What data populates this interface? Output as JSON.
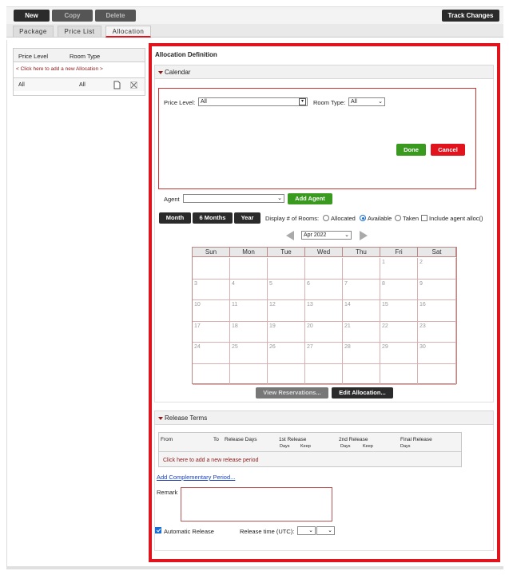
{
  "toolbar": {
    "new": "New",
    "copy": "Copy",
    "delete": "Delete",
    "track_changes": "Track Changes"
  },
  "tabs": [
    {
      "label": "Package"
    },
    {
      "label": "Price List"
    },
    {
      "label": "Allocation",
      "active": true
    }
  ],
  "left": {
    "col_price_level": "Price Level",
    "col_room_type": "Room Type",
    "add_link": "< Click here to add a new Allocation >",
    "rows": [
      {
        "price_level": "All",
        "room_type": "All"
      }
    ]
  },
  "definition": {
    "title": "Allocation Definition",
    "calendar_section": "Calendar",
    "price_level_label": "Price Level:",
    "price_level_value": "All",
    "room_type_label": "Room Type:",
    "room_type_value": "All",
    "done": "Done",
    "cancel": "Cancel",
    "agent_label": "Agent",
    "agent_value": "",
    "add_agent": "Add Agent",
    "view_month": "Month",
    "view_6months": "6 Months",
    "view_year": "Year",
    "display_label": "Display # of Rooms:",
    "opt_allocated": "Allocated",
    "opt_available": "Available",
    "opt_taken": "Taken",
    "include_agent": "Include agent alloc()",
    "month_value": "Apr 2022",
    "weekdays": [
      "Sun",
      "Mon",
      "Tue",
      "Wed",
      "Thu",
      "Fri",
      "Sat"
    ],
    "days": [
      [
        "",
        "",
        "",
        "",
        "",
        "1",
        "2"
      ],
      [
        "3",
        "4",
        "5",
        "6",
        "7",
        "8",
        "9"
      ],
      [
        "10",
        "11",
        "12",
        "13",
        "14",
        "15",
        "16"
      ],
      [
        "17",
        "18",
        "19",
        "20",
        "21",
        "22",
        "23"
      ],
      [
        "24",
        "25",
        "26",
        "27",
        "28",
        "29",
        "30"
      ],
      [
        "",
        "",
        "",
        "",
        "",
        "",
        ""
      ]
    ],
    "view_reservations": "View Reservations...",
    "edit_allocation": "Edit Allocation..."
  },
  "release": {
    "section": "Release Terms",
    "col_from": "From",
    "col_to": "To",
    "col_release_days": "Release Days",
    "col_1st": "1st Release",
    "col_2nd": "2nd Release",
    "col_final": "Final Release",
    "sub_days": "Days",
    "sub_keep": "Keep",
    "add_period": "Click here to add a new release period",
    "add_comp": "Add Complementary Period...",
    "remark_label": "Remark",
    "auto_release": "Automatic Release",
    "release_time_label": "Release time (UTC):"
  },
  "colors": {
    "accent_red": "#e1131d",
    "green": "#3a9a1f",
    "dark": "#2b2b2b"
  }
}
